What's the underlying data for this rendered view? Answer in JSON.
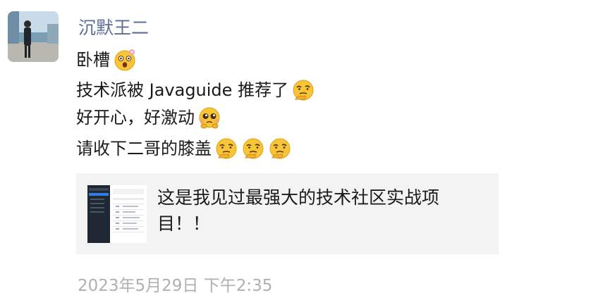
{
  "sender": {
    "name": "沉默王二"
  },
  "messages": [
    {
      "text": "卧槽",
      "emojis": [
        "shocked-emoji-icon"
      ]
    },
    {
      "text": "技术派被 Javaguide 推荐了",
      "emojis": [
        "hand-on-chin-emoji-icon"
      ]
    },
    {
      "text": "好开心，好激动",
      "emojis": [
        "pleading-emoji-icon"
      ]
    },
    {
      "text": "请收下二哥的膝盖",
      "emojis": [
        "hand-on-chin-emoji-icon",
        "hand-on-chin-emoji-icon",
        "hand-on-chin-emoji-icon"
      ]
    }
  ],
  "link_card": {
    "title": "这是我见过最强大的技术社区实战项目！！"
  },
  "timestamp": "2023年5月29日 下午2:35",
  "colors": {
    "name": "#5b6f94",
    "card_bg": "#f3f3f3",
    "timestamp": "#b0b0b0"
  }
}
